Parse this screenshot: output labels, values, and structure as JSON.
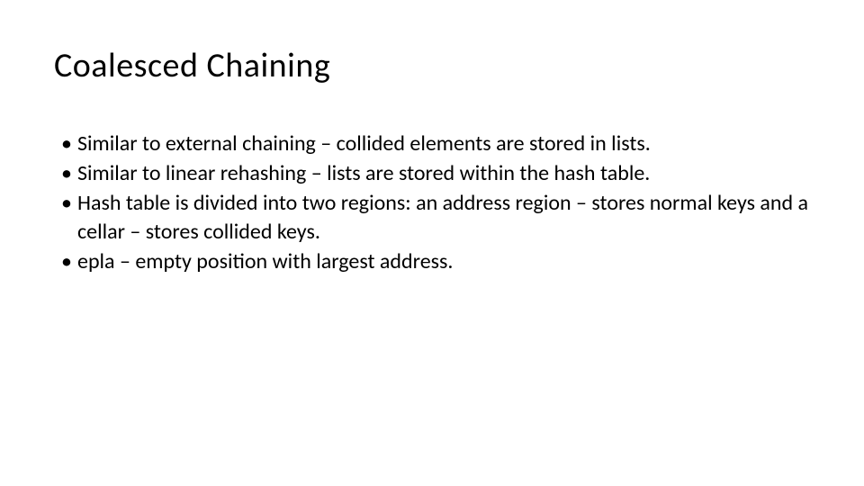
{
  "slide": {
    "title": "Coalesced Chaining",
    "bullets": [
      "Similar to external chaining – collided elements are stored in lists.",
      "Similar to linear rehashing – lists are stored within the hash table.",
      "Hash table is divided into two regions: an address region – stores normal keys and a cellar – stores collided keys.",
      "epla – empty position with largest address."
    ]
  }
}
